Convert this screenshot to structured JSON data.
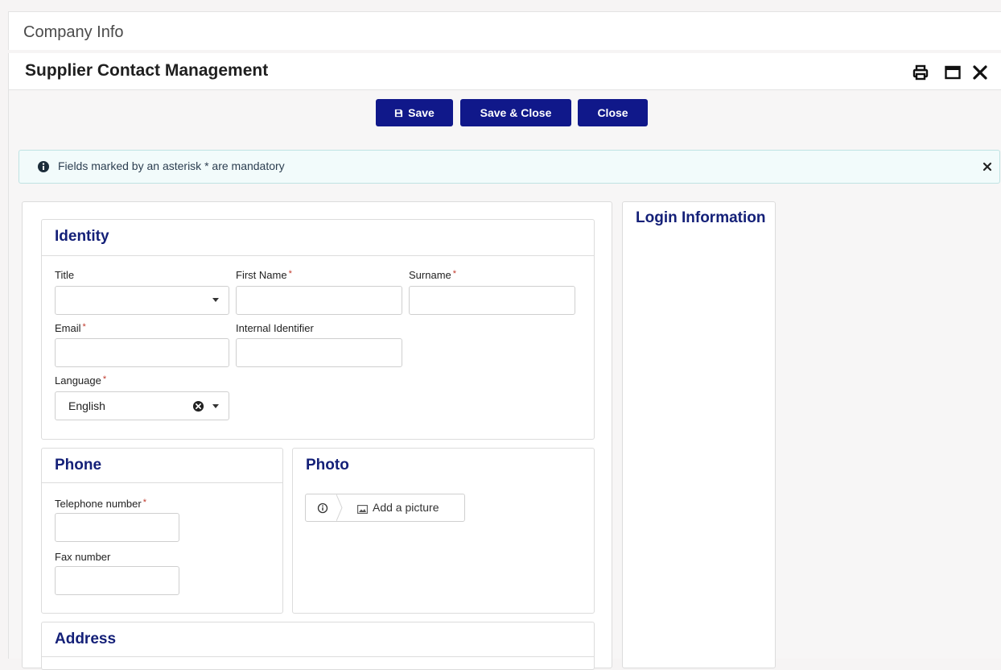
{
  "company": {
    "title": "Company Info"
  },
  "modal": {
    "title": "Supplier Contact Management"
  },
  "toolbar": {
    "save": "Save",
    "save_close": "Save & Close",
    "close": "Close"
  },
  "notice": {
    "text": "Fields marked by an asterisk * are mandatory"
  },
  "identity": {
    "heading": "Identity",
    "title_label": "Title",
    "first_name_label": "First Name",
    "surname_label": "Surname",
    "email_label": "Email",
    "internal_id_label": "Internal Identifier",
    "language_label": "Language",
    "language_value": "English",
    "required_mark": "*"
  },
  "phone": {
    "heading": "Phone",
    "telephone_label": "Telephone number",
    "fax_label": "Fax number"
  },
  "photo": {
    "heading": "Photo",
    "add_picture": "Add a picture"
  },
  "address": {
    "heading": "Address"
  },
  "login": {
    "heading": "Login Information"
  },
  "colors": {
    "primary": "#10188a",
    "heading": "#142078",
    "required": "#c0392b"
  }
}
